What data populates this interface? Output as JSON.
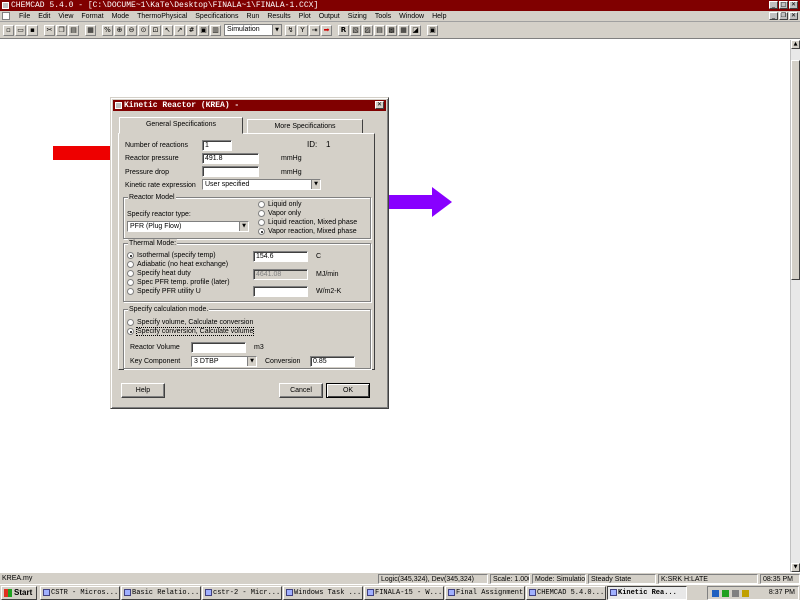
{
  "window": {
    "title": "CHEMCAD 5.4.0 - [C:\\DOCUME~1\\KaTe\\Desktop\\FINALA~1\\FINALA-1.CCX]"
  },
  "menu": [
    "File",
    "Edit",
    "View",
    "Format",
    "Mode",
    "ThermoPhysical",
    "Specifications",
    "Run",
    "Results",
    "Plot",
    "Output",
    "Sizing",
    "Tools",
    "Window",
    "Help"
  ],
  "toolbar": {
    "mode_value": "Simulation"
  },
  "dialog": {
    "title": "Kinetic Reactor (KREA) -",
    "close_glyph": "✕",
    "tabs": [
      "General Specifications",
      "More Specifications"
    ],
    "id_label": "ID:",
    "id_value": "1",
    "num_reactions_label": "Number of reactions",
    "num_reactions_value": "1",
    "reactor_pressure_label": "Reactor pressure",
    "reactor_pressure_value": "491.8",
    "pressure_unit": "mmHg",
    "pressure_drop_label": "Pressure drop",
    "pressure_drop_value": "",
    "pressure_drop_unit": "mmHg",
    "kinetic_rate_label": "Kinetic rate expression",
    "kinetic_rate_value": "User specified",
    "reactor_model": {
      "title": "Reactor Model",
      "type_label": "Specify reactor type:",
      "type_value": "PFR (Plug Flow)",
      "options": [
        "Liquid only",
        "Vapor only",
        "Liquid reaction, Mixed phase",
        "Vapor reaction, Mixed phase"
      ],
      "selected_index": 3
    },
    "thermal_mode": {
      "title": "Thermal Mode:",
      "options": [
        "Isothermal (specify temp)",
        "Adiabatic (no heat exchange)",
        "Specify heat duty",
        "Spec PFR temp. profile (later)",
        "Specify PFR utility U"
      ],
      "selected_index": 0,
      "temp_value": "154.6",
      "temp_unit": "C",
      "duty_value": "4641.08",
      "duty_unit": "MJ/min",
      "utility_value": "",
      "utility_unit": "W/m2-K"
    },
    "calc_mode": {
      "title": "Specify calculation mode.",
      "options": [
        "Specify volume, Calculate conversion",
        "Specify conversion, Calculate volume"
      ],
      "selected_index": 1,
      "volume_label": "Reactor Volume",
      "volume_value": "",
      "volume_unit": "m3",
      "key_component_label": "Key Component",
      "key_component_value": "3 DTBP",
      "conversion_label": "Conversion",
      "conversion_value": "0.85"
    },
    "buttons": {
      "help": "Help",
      "cancel": "Cancel",
      "ok": "OK"
    }
  },
  "statusbar": {
    "file": "KREA.my",
    "logic": "Logic(345,324), Dev(345,324)",
    "scale": "Scale: 1.000",
    "mode": "Mode: Simulation",
    "state": "Steady State",
    "thermo": "K:SRK H:LATE",
    "time": "08:35 PM"
  },
  "taskbar": {
    "start": "Start",
    "tasks": [
      "CSTR - Micros...",
      "Basic Relatio...",
      "cstr-2 - Micr...",
      "Windows Task ...",
      "FINALA-15 - W...",
      "Final Assignment",
      "CHEMCAD 5.4.0...",
      "Kinetic Rea..."
    ],
    "active_index": 7,
    "clock": "8:37 PM"
  },
  "colors": {
    "title_bar": "#800000",
    "red_stream": "#ee0000",
    "purple_arrow": "#8800ff"
  }
}
